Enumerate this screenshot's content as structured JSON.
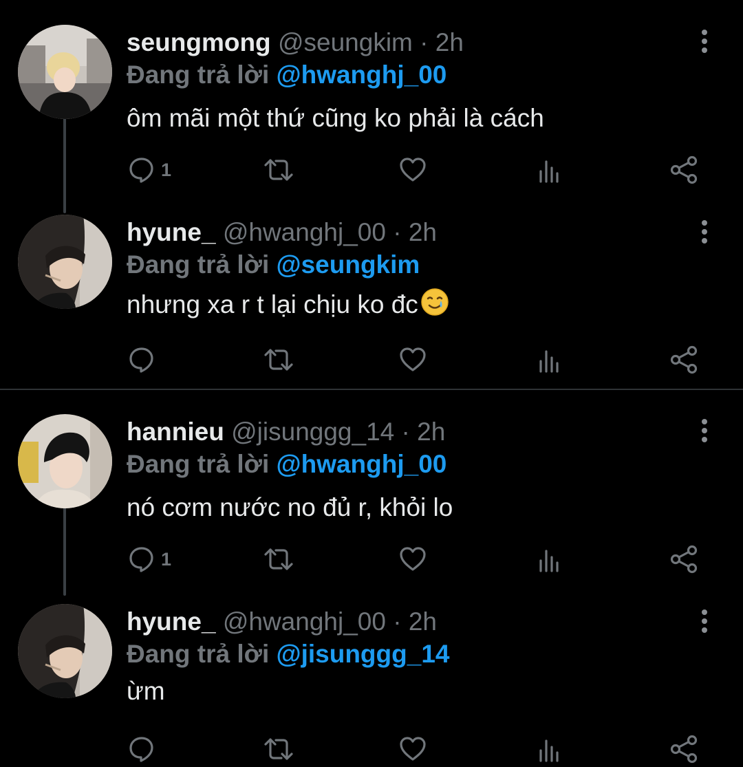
{
  "reply_prefix": "Đang trả lời",
  "tweets": [
    {
      "display_name": "seungmong",
      "handle_time": "@seungkim · 2h",
      "reply_to": "@hwanghj_00",
      "text": "ôm mãi một thứ cũng ko phải là cách",
      "reply_count": "1",
      "avatar": "selfie-blond-hair"
    },
    {
      "display_name": "hyune_",
      "handle_time": "@hwanghj_00 · 2h",
      "reply_to": "@seungkim",
      "text": "nhưng xa r t lại chịu ko đc",
      "text_emoji": "smiling-face-with-tear",
      "reply_count": "",
      "avatar": "selfie-dark-hair"
    },
    {
      "display_name": "hannieu",
      "handle_time": "@jisunggg_14 · 2h",
      "reply_to": "@hwanghj_00",
      "text": "nó cơm nước no đủ r, khỏi lo",
      "reply_count": "1",
      "avatar": "selfie-black-hair"
    },
    {
      "display_name": "hyune_",
      "handle_time": "@hwanghj_00 · 2h",
      "reply_to": "@jisunggg_14",
      "text": "ừm",
      "reply_count": "",
      "avatar": "selfie-dark-hair"
    }
  ],
  "icons": {
    "reply": "reply-icon",
    "retweet": "retweet-icon",
    "like": "like-icon",
    "views": "views-icon",
    "share": "share-icon",
    "more": "more-vertical-icon"
  },
  "colors": {
    "background": "#000000",
    "text": "#e7e9ea",
    "secondary": "#71767b",
    "mention": "#1d9bf0",
    "divider": "#2f3336",
    "thread_line": "#3a3f44"
  }
}
